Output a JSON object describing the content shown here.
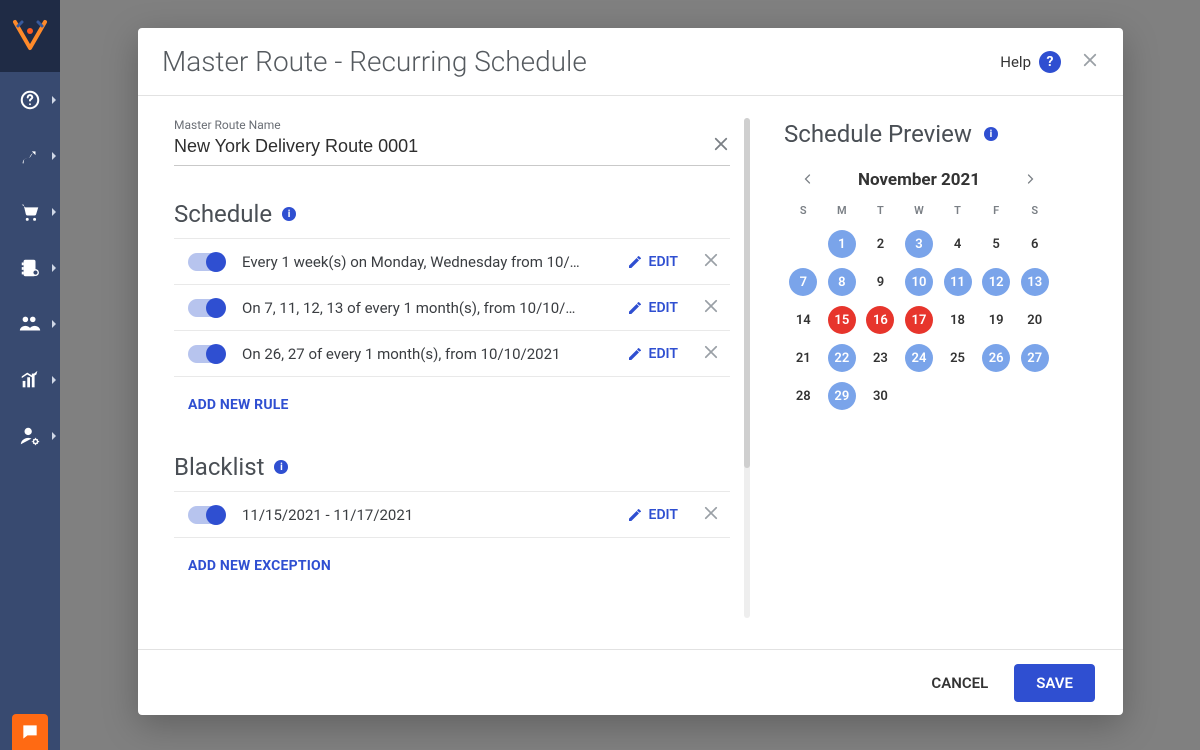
{
  "sidebar": {
    "chat_icon": "chat"
  },
  "modal": {
    "title": "Master Route - Recurring Schedule",
    "help_label": "Help",
    "help_icon": "?",
    "route_name_label": "Master Route Name",
    "route_name_value": "New York Delivery Route 0001",
    "schedule_title": "Schedule",
    "schedule_rules": [
      {
        "text": "Every 1 week(s) on Monday, Wednesday from 10/…",
        "edit": "EDIT"
      },
      {
        "text": "On 7, 11, 12, 13 of every 1 month(s), from 10/10/…",
        "edit": "EDIT"
      },
      {
        "text": "On 26, 27 of every 1 month(s), from 10/10/2021",
        "edit": "EDIT"
      }
    ],
    "add_rule_label": "ADD NEW RULE",
    "blacklist_title": "Blacklist",
    "blacklist_rules": [
      {
        "text": "11/15/2021 - 11/17/2021",
        "edit": "EDIT"
      }
    ],
    "add_exception_label": "ADD NEW EXCEPTION",
    "footer": {
      "cancel": "CANCEL",
      "save": "SAVE"
    }
  },
  "preview": {
    "title": "Schedule Preview",
    "month_label": "November 2021",
    "dow": [
      "S",
      "M",
      "T",
      "W",
      "T",
      "F",
      "S"
    ],
    "leading_blank": 1,
    "days_in_month": 30,
    "scheduled": [
      1,
      3,
      7,
      8,
      10,
      11,
      12,
      13,
      22,
      24,
      26,
      27,
      29
    ],
    "blacklisted": [
      15,
      16,
      17
    ]
  }
}
